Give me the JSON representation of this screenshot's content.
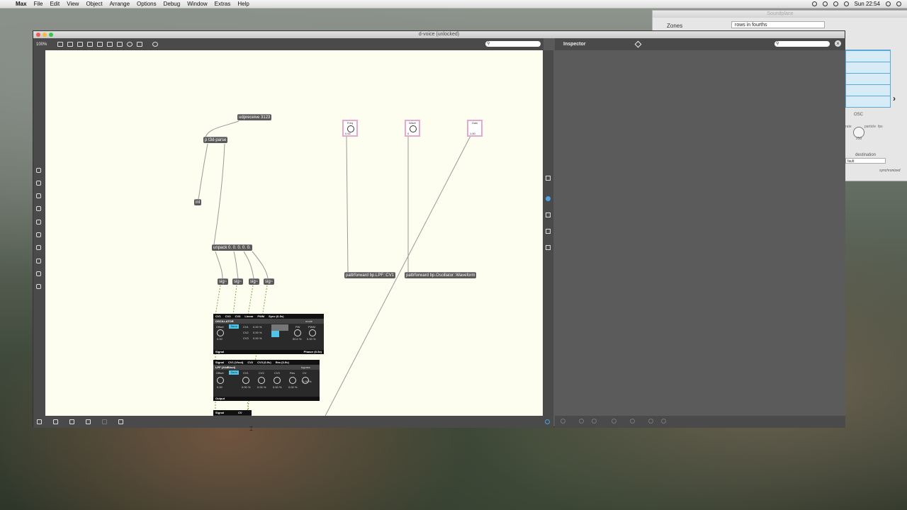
{
  "menubar": {
    "app": "Max",
    "items": [
      "File",
      "Edit",
      "View",
      "Object",
      "Arrange",
      "Options",
      "Debug",
      "Window",
      "Extras",
      "Help"
    ],
    "clock": "Sun 22:54"
  },
  "soundplane": {
    "title": "Soundplane",
    "zones_label": "Zones",
    "zones_value": "rows in fourths",
    "osc_label": "OSC",
    "dest_label": "destination",
    "dest_value": "fault",
    "sync_label": "synchronized",
    "small_labels": [
      "rate",
      "particle",
      "fps"
    ],
    "knob_value": "250"
  },
  "max_window": {
    "title": "d-voice (unlocked)",
    "zoom": "100%",
    "inspector_title": "Inspector",
    "close_glyph": "×"
  },
  "patch": {
    "objects": {
      "udpreceive": "udpreceive 3123",
      "parse": "p t3d-parse",
      "int": "int",
      "unpack": "unpack 0. 0. 0. 0. 0.",
      "sig1": "sig~",
      "sig2": "sig~",
      "sig3": "sig~",
      "sig4": "sig~",
      "pf_lpf": "pattrforward bp.LPF::CV1",
      "pf_osc": "pattrforward bp.Oscillator::Waveform"
    },
    "dials": {
      "freq": {
        "label": "Freq",
        "value": "0.00"
      },
      "wave": {
        "label": "Wave",
        "value": "0"
      },
      "gain": {
        "label": "Gain",
        "value": "1.00"
      }
    },
    "osc_module": {
      "inlets": [
        "CV1",
        "CV2",
        "CV3",
        "Linear",
        "PWM",
        "Sync (0-5v)"
      ],
      "title": "OSCILLATOR",
      "mode": "mode",
      "offset": "Offset",
      "semi": "Semi",
      "cv_labels": [
        "CV1",
        "CV2",
        "CV3"
      ],
      "cv_values": [
        "0.00 %",
        "0.00 %",
        "0.00 %"
      ],
      "pw": "PW",
      "pwm": "PWM",
      "pw_value": "50.0 %",
      "pwm_value": "0.00 %",
      "offset_value": "0.00",
      "outlets_left": "Signal",
      "outlets_right": "Phasor (0-5v)"
    },
    "lpf_module": {
      "inlets": [
        "Signal",
        "CV1 (V/oct)",
        "CV2",
        "CV3 (0-5v)",
        "Res (0-5v)"
      ],
      "title": "LPF (24dB/oct)",
      "bypass": "bypass",
      "offset": "Offset",
      "semi": "Semi",
      "labels": [
        "CV1",
        "CV2",
        "CV3",
        "Res",
        "CV"
      ],
      "values": [
        "0.00",
        "0.00 %",
        "0.00 %",
        "0.00 %",
        "0.00 %",
        "0.00 %"
      ],
      "outlet": "Output"
    },
    "next_module": {
      "inlets": [
        "Signal",
        "CV"
      ]
    }
  },
  "colors": {
    "canvas": "#fdfdf0",
    "object_bg": "#595959",
    "patch_cord": "#9a9a9a",
    "signal_cord": "#7fa84a",
    "dial_border": "#e7a8cf",
    "inspector_bg": "#5b5b5b"
  }
}
